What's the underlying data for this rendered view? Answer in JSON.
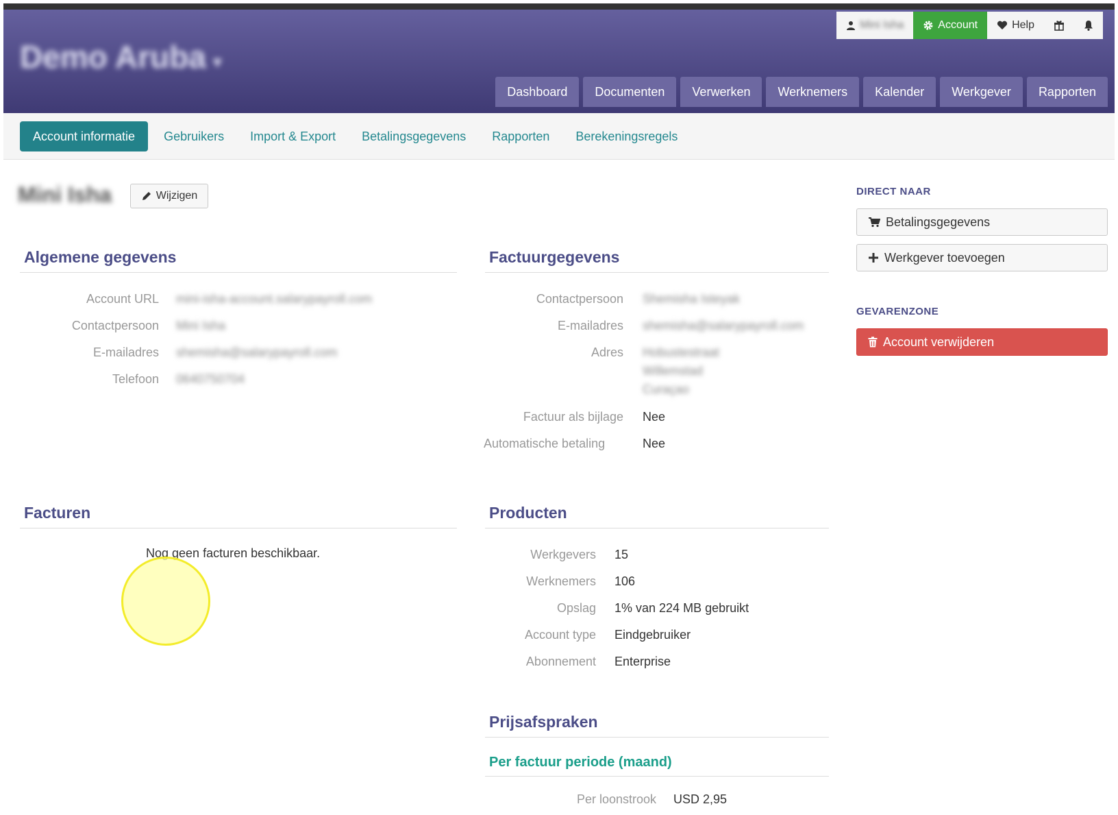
{
  "header": {
    "brand": "Demo Aruba",
    "brand_caret": "▾",
    "userbar": {
      "username": "Mini Isha",
      "account_label": "Account",
      "help_label": "Help"
    },
    "main_nav": [
      "Dashboard",
      "Documenten",
      "Verwerken",
      "Werknemers",
      "Kalender",
      "Werkgever",
      "Rapporten"
    ]
  },
  "sub_nav": {
    "tabs": [
      "Account informatie",
      "Gebruikers",
      "Import & Export",
      "Betalingsgegevens",
      "Rapporten",
      "Berekeningsregels"
    ],
    "active": "Account informatie"
  },
  "profile": {
    "name": "Mini Isha",
    "edit_label": "Wijzigen"
  },
  "algemene": {
    "title": "Algemene gegevens",
    "rows": [
      {
        "label": "Account URL",
        "value": "mini-isha-account.salarypayroll.com"
      },
      {
        "label": "Contactpersoon",
        "value": "Mini Isha"
      },
      {
        "label": "E-mailadres",
        "value": "shemisha@salarypayroll.com"
      },
      {
        "label": "Telefoon",
        "value": "0640750704"
      }
    ]
  },
  "factuur": {
    "title": "Factuurgegevens",
    "contact_label": "Contactpersoon",
    "contact_value": "Shemisha Isteyak",
    "email_label": "E-mailadres",
    "email_value": "shemisha@salarypayroll.com",
    "adres_label": "Adres",
    "adres_lines": [
      "Hobustestraat",
      "Willemstad",
      "Curaçao"
    ],
    "bijlage_label": "Factuur als bijlage",
    "bijlage_value": "Nee",
    "auto_label": "Automatische betaling",
    "auto_value": "Nee"
  },
  "facturen": {
    "title": "Facturen",
    "empty": "Nog geen facturen beschikbaar."
  },
  "producten": {
    "title": "Producten",
    "rows": [
      {
        "label": "Werkgevers",
        "value": "15"
      },
      {
        "label": "Werknemers",
        "value": "106"
      },
      {
        "label": "Opslag",
        "value": "1% van 224 MB gebruikt"
      },
      {
        "label": "Account type",
        "value": "Eindgebruiker"
      },
      {
        "label": "Abonnement",
        "value": "Enterprise"
      }
    ]
  },
  "prijs": {
    "title": "Prijsafspraken",
    "subtitle": "Per factuur periode (maand)",
    "rows": [
      {
        "label": "Per loonstrook",
        "value": "USD 2,95"
      }
    ]
  },
  "sidebar": {
    "direct_title": "DIRECT NAAR",
    "payment_button": "Betalingsgegevens",
    "add_employer_button": "Werkgever toevoegen",
    "danger_title": "GEVARENZONE",
    "delete_button": "Account verwijderen"
  },
  "colors": {
    "header_top": "#65609e",
    "header_bottom": "#3f3a74",
    "account_green": "#3ea53e",
    "tab_active": "#23828a",
    "heading": "#4b4d87",
    "subheading": "#1a9e8a",
    "danger": "#d9534f"
  }
}
